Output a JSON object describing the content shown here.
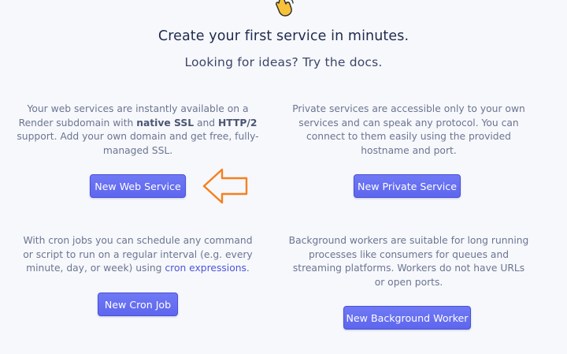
{
  "header": {
    "title": "Create your first service in minutes.",
    "subtitle": "Looking for ideas? Try the docs.",
    "wave_icon": "waving-hand-icon"
  },
  "services": {
    "web": {
      "desc_1": "Your web services are instantly available on a Render subdomain with ",
      "desc_bold_1": "native SSL",
      "desc_2": " and ",
      "desc_bold_2": "HTTP/2",
      "desc_3": " support. Add your own domain and get free, fully-managed SSL.",
      "button": "New Web Service"
    },
    "private": {
      "desc": "Private services are accessible only to your own services and can speak any protocol. You can connect to them easily using the provided hostname and port.",
      "button": "New Private Service"
    },
    "cron": {
      "desc_1": "With cron jobs you can schedule any command or script to run on a regular interval (e.g. every minute, day, or week) using ",
      "desc_link": "cron expressions",
      "desc_2": ".",
      "button": "New Cron Job"
    },
    "worker": {
      "desc": "Background workers are suitable for long running processes like consumers for queues and streaming platforms. Workers do not have URLs or open ports.",
      "button": "New Background Worker"
    }
  },
  "annotation": {
    "arrow_icon": "arrow-left-icon",
    "arrow_color": "#f5801f"
  },
  "colors": {
    "button_bg": "#6570f2",
    "link": "#4c55d8"
  }
}
